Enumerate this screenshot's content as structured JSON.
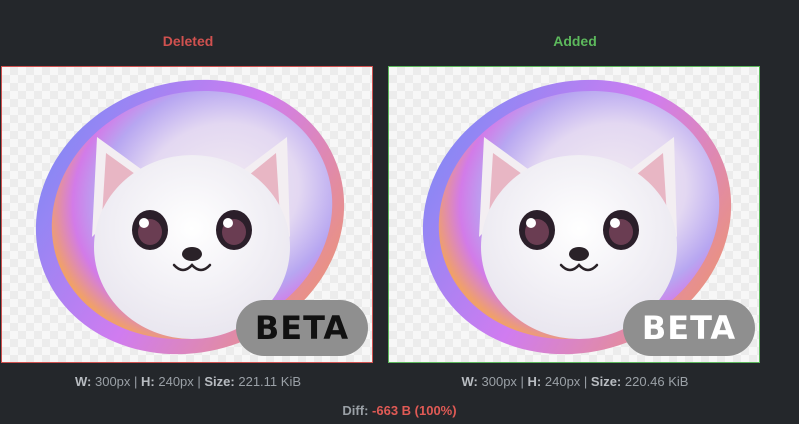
{
  "labels": {
    "deleted": "Deleted",
    "added": "Added"
  },
  "deleted_image": {
    "badge_text": "BETA",
    "w_label": "W:",
    "w_value": "300px",
    "h_label": "H:",
    "h_value": "240px",
    "size_label": "Size:",
    "size_value": "221.11 KiB"
  },
  "added_image": {
    "badge_text": "BETA",
    "w_label": "W:",
    "w_value": "300px",
    "h_label": "H:",
    "h_value": "240px",
    "size_label": "Size:",
    "size_value": "220.46 KiB"
  },
  "diff": {
    "label": "Diff:",
    "value": "-663 B (100%)"
  },
  "colors": {
    "deleted": "#d0514f",
    "added": "#5cb85c",
    "background": "#24272b"
  },
  "icons": {
    "artwork": "cartoon-white-puppy-in-iridescent-bubble"
  }
}
